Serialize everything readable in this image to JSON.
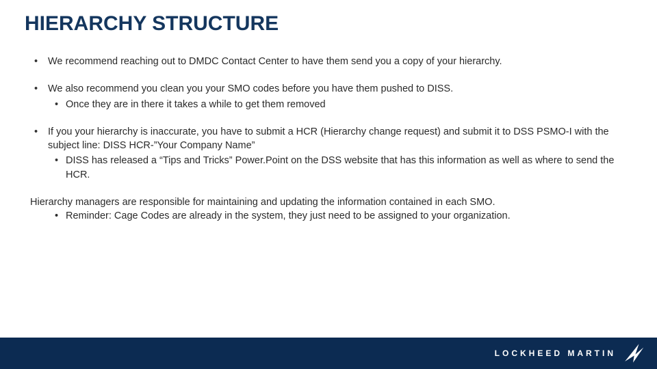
{
  "title": "HIERARCHY STRUCTURE",
  "bullets": [
    {
      "text": "We recommend reaching out to DMDC Contact Center to have them send you a copy of your hierarchy."
    },
    {
      "text": "We also recommend you clean you your SMO codes before you have them pushed to DISS.",
      "sub": [
        "Once they are in there it takes a while to get them removed"
      ]
    },
    {
      "text": "If you your hierarchy is inaccurate, you have to submit a HCR (Hierarchy change request) and submit it to DSS PSMO-I with the subject line: DISS HCR-”Your Company Name”",
      "sub": [
        "DISS has released a “Tips and Tricks” Power.Point on the DSS website that has this information as well as where to send the HCR."
      ]
    }
  ],
  "paragraph": {
    "text": "Hierarchy managers are responsible for maintaining and updating the information contained in each SMO.",
    "sub": "Reminder: Cage Codes are already in the system, they just need to be assigned to your organization."
  },
  "footer": {
    "brand": "LOCKHEED MARTIN"
  }
}
